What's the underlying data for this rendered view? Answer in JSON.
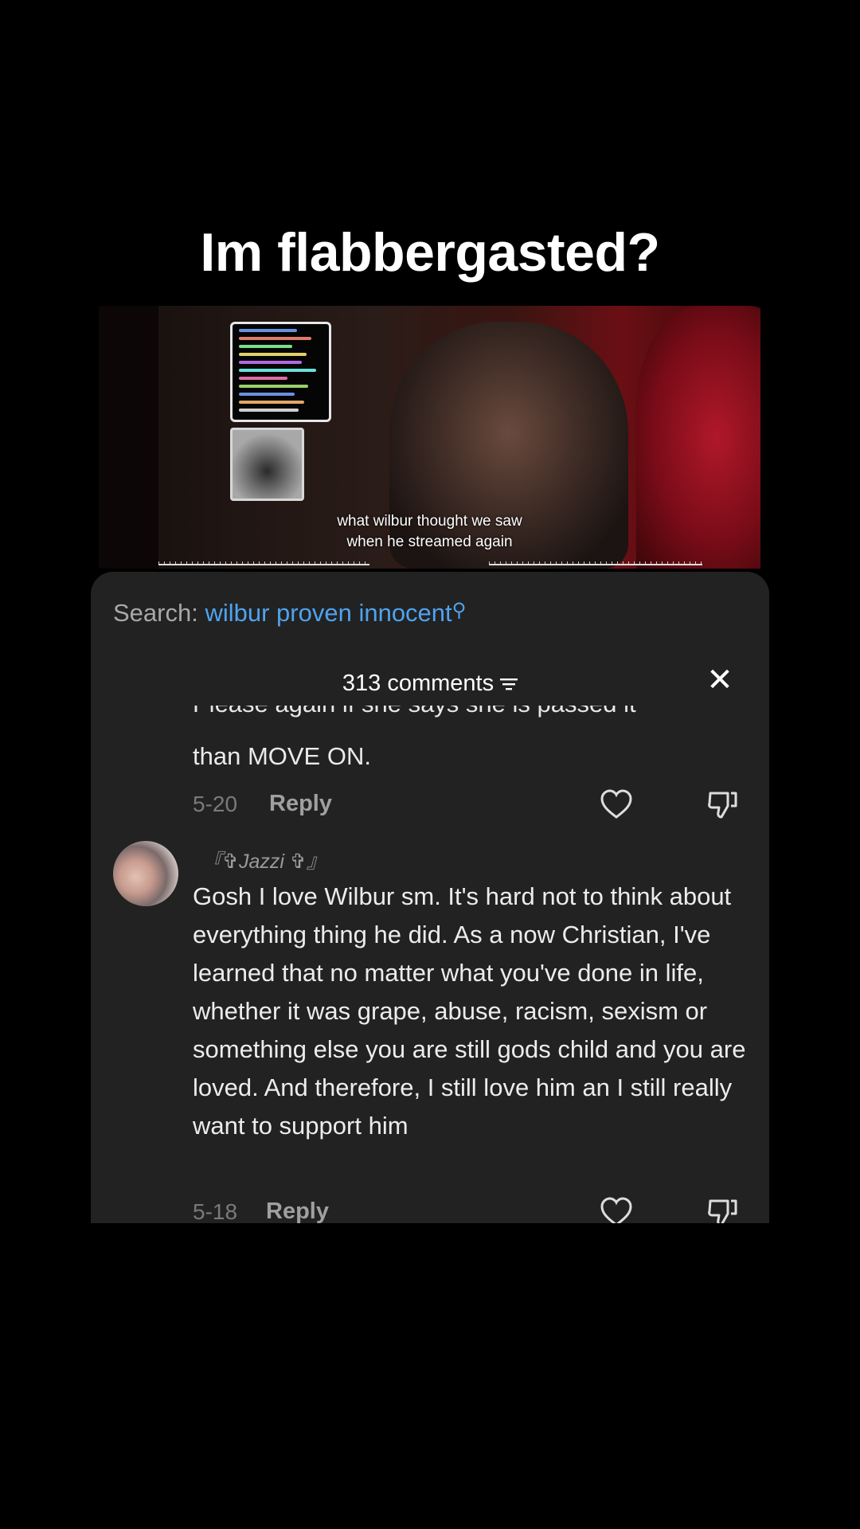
{
  "title": "Im flabbergasted?",
  "video": {
    "caption_line1": "what wilbur thought we saw",
    "caption_line2": "when he streamed again"
  },
  "search": {
    "label": "Search:",
    "term": "wilbur proven innocent"
  },
  "comments_header": {
    "count_text": "313 comments"
  },
  "previous_comment": {
    "cut_text": "Please again if she says she is passed it",
    "last_line": "than MOVE ON.",
    "date": "5-20",
    "reply_label": "Reply"
  },
  "comment": {
    "username": "『✞Jazzi ✞』",
    "text": "Gosh I love Wilbur sm. It's hard not to think about everything thing he did. As a now Christian, I've learned that no matter what you've done in life, whether it was grape, abuse, racism, sexism or something else you are still gods child and you are loved. And therefore, I still love him an I still really want to support him",
    "date": "5-18",
    "reply_label": "Reply"
  },
  "icons": {
    "search": "search-icon",
    "filter": "filter-icon",
    "close": "close-icon",
    "like": "heart-icon",
    "dislike": "thumbs-down-icon"
  },
  "colors": {
    "background": "#000000",
    "panel": "#222222",
    "search_term": "#4fa3ef"
  }
}
